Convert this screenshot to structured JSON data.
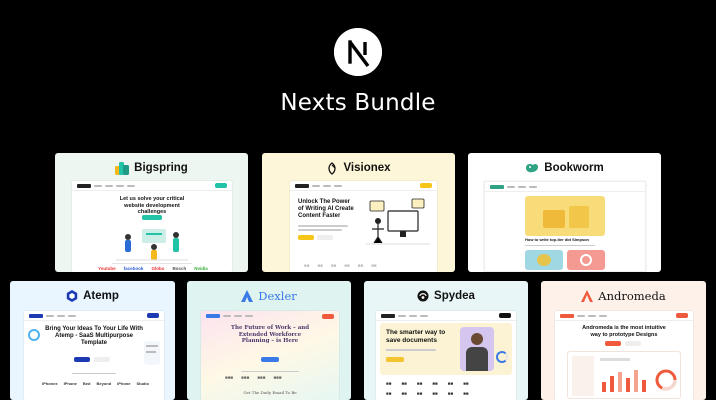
{
  "title": "Nexts Bundle",
  "logo_icon": "nextjs-n-icon",
  "colors": {
    "background": "#000000",
    "title": "#ffffff"
  },
  "templates": [
    {
      "name": "Bigspring",
      "icon": "bigspring-leaf-icon",
      "accent": "#22c3a6",
      "bg": "#eef6f2",
      "hero": "Let us solve your critical website development challenges",
      "logos": [
        "Youtube",
        "facebook",
        "Globo",
        "Bosch",
        "Nvidia"
      ]
    },
    {
      "name": "Visionex",
      "icon": "visionex-swirl-icon",
      "accent": "#f5c518",
      "bg": "#fdf6d8",
      "hero": "Unlock The Power of Writing AI Create Content Faster"
    },
    {
      "name": "Bookworm",
      "icon": "bookworm-leaf-icon",
      "accent": "#2fa384",
      "bg": "#ffffff",
      "hero": "How to write top-tier dbt Simpson"
    },
    {
      "name": "Atemp",
      "icon": "atemp-hexagon-icon",
      "accent": "#1d3ab3",
      "bg": "#e9f5ff",
      "hero": "Bring Your Ideas To Your Life With Atemp - SaaS Multipurpose Template",
      "logos": [
        "iPhonex",
        "IPhone",
        "Bed",
        "Beyond",
        "iPhone",
        "Studio"
      ]
    },
    {
      "name": "Dexler",
      "icon": "dexler-a-icon",
      "accent": "#3a79e8",
      "bg": "#dff4f1",
      "hero": "The Future of Work – and Extended Workforce Planning – is Here",
      "footer": "Get The Daily Email To Be"
    },
    {
      "name": "Spydea",
      "icon": "spydea-bug-icon",
      "accent": "#f4c430",
      "bg": "#e9f6f8",
      "hero": "The smarter way to save documents"
    },
    {
      "name": "Andromeda",
      "icon": "andromeda-a-icon",
      "accent": "#ef5a3c",
      "bg": "#fdf1ea",
      "hero": "Andromeda is the most intuitive way to prototype Designs"
    }
  ]
}
